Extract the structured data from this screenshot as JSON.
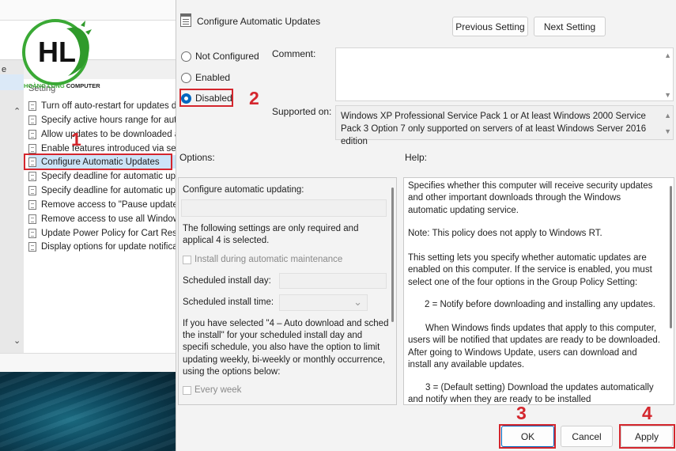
{
  "background": {
    "pane_label": "e",
    "list_header": "Setting",
    "policies": [
      "Turn off auto-restart for updates d",
      "Specify active hours range for auto",
      "Allow updates to be downloaded a",
      "Enable features introduced via serv",
      "Configure Automatic Updates",
      "Specify deadline for automatic upd",
      "Specify deadline for automatic upc",
      "Remove access to \"Pause updates\"",
      "Remove access to use all Windows",
      "Update Power Policy for Cart Resta",
      "Display options for update notifica"
    ],
    "selected_index": 4,
    "scroll_up": "⌃",
    "scroll_down": "⌄"
  },
  "logo": {
    "letters": "HL",
    "caption_green": "HOÀNG LONG",
    "caption_dark": " COMPUTER"
  },
  "dialog": {
    "title": "Configure Automatic Updates",
    "prev_button": "Previous Setting",
    "next_button": "Next Setting",
    "radios": {
      "not_configured": "Not Configured",
      "enabled": "Enabled",
      "disabled": "Disabled",
      "selected": "disabled"
    },
    "comment_label": "Comment:",
    "supported_label": "Supported on:",
    "supported_text": "Windows XP Professional Service Pack 1 or At least Windows 2000 Service Pack 3 Option 7 only supported on servers of at least Windows Server 2016 edition",
    "options_label": "Options:",
    "help_label": "Help:",
    "options": {
      "configure_label": "Configure automatic updating:",
      "note": "The following settings are only required and applical 4 is selected.",
      "install_maintenance": "Install during automatic maintenance",
      "install_day_label": "Scheduled install day:",
      "install_time_label": "Scheduled install time:",
      "auto_text": "If you have selected \"4 – Auto download and sched the install\" for your scheduled install day and specifi schedule, you also have the option to limit updating weekly, bi-weekly or monthly occurrence, using the options below:",
      "every_week": "Every week"
    },
    "help": [
      "Specifies whether this computer will receive security updates and other important downloads through the Windows automatic updating service.",
      "Note: This policy does not apply to Windows RT.",
      "This setting lets you specify whether automatic updates are enabled on this computer. If the service is enabled, you must select one of the four options in the Group Policy Setting:",
      "2 = Notify before downloading and installing any updates.",
      "When Windows finds updates that apply to this computer, users will be notified that updates are ready to be downloaded. After going to Windows Update, users can download and install any available updates.",
      "3 = (Default setting) Download the updates automatically and notify when they are ready to be installed"
    ],
    "ok_button": "OK",
    "cancel_button": "Cancel",
    "apply_button": "Apply"
  },
  "annotations": {
    "step1": "1",
    "step2": "2",
    "step3": "3",
    "step4": "4",
    "color": "#d4262d"
  }
}
